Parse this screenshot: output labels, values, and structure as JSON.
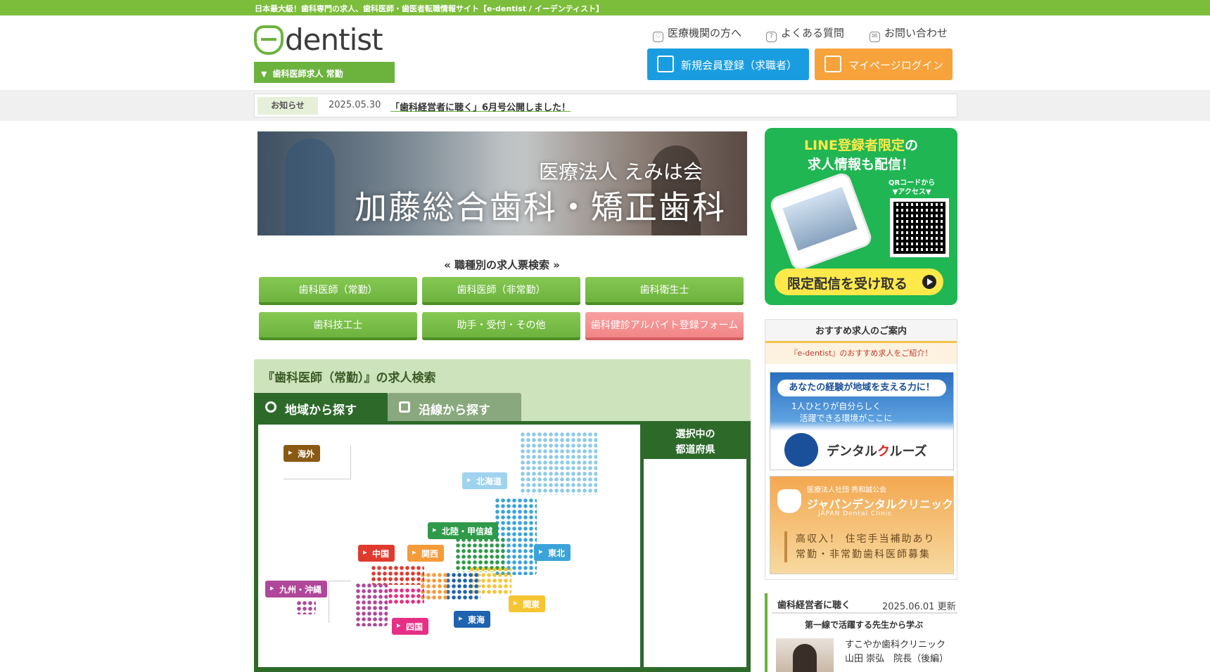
{
  "topbar": {
    "text": "日本最大級！歯科専門の求人、歯科医師・歯医者転職情報サイト【e-dentist / イーデンティスト】"
  },
  "logo": {
    "text": "dentist"
  },
  "job_select": {
    "label": "歯科医師求人 常勤"
  },
  "header_links": [
    {
      "label": "医療機関の方へ",
      "icon": "tooth-icon"
    },
    {
      "label": "よくある質問",
      "icon": "question-icon"
    },
    {
      "label": "お問い合わせ",
      "icon": "mail-icon"
    }
  ],
  "buttons": {
    "register": "新規会員登録（求職者）",
    "login": "マイページログイン"
  },
  "colors": {
    "brand_green": "#6cb33e",
    "register_blue": "#1a9de0",
    "login_orange": "#f7a23b",
    "line_green": "#1fb653"
  },
  "news": {
    "label": "お知らせ",
    "date": "2025.05.30",
    "link": "「歯科経営者に聴く」6月号公開しました！"
  },
  "hero": {
    "sub": "医療法人 えみは会",
    "main": "加藤総合歯科・矯正歯科"
  },
  "job_search": {
    "heading": "« 職種別の求人票検索 »",
    "buttons": [
      {
        "label": "歯科医師（常勤）"
      },
      {
        "label": "歯科医師（非常勤）"
      },
      {
        "label": "歯科衛生士"
      },
      {
        "label": "歯科技工士"
      },
      {
        "label": "助手・受付・その他"
      },
      {
        "label": "歯科健診アルバイト登録フォーム"
      }
    ]
  },
  "search_panel": {
    "title": "『歯科医師（常勤）』の求人検索",
    "tabs": [
      {
        "label": "地域から探す"
      },
      {
        "label": "沿線から探す"
      }
    ],
    "selected_header": "選択中の\n都道府県",
    "regions": {
      "overseas": "海外",
      "hokkaido": "北海道",
      "tohoku": "東北",
      "hokuriku": "北陸・甲信越",
      "kanto": "関東",
      "tokai": "東海",
      "kansai": "関西",
      "chugoku": "中国",
      "shikoku": "四国",
      "kyushu": "九州・沖縄"
    }
  },
  "line_banner": {
    "line1_a": "LINE登録者限定",
    "line1_b": "の",
    "line2": "求人情報も配信！",
    "qr_label": "QRコードから\n▼アクセス▼",
    "cta": "限定配信を受け取る"
  },
  "recommend": {
    "title": "おすすめ求人のご案内",
    "subtitle": "『e-dentist』のおすすめ求人をご紹介！",
    "ad1": {
      "headline": "あなたの経験が地域を支える力に！",
      "sub": "1人ひとりが自分らしく\n   活躍できる環境がここに",
      "name_a": "デンタル",
      "name_b": "ク",
      "name_c": "ルーズ"
    },
    "ad2": {
      "corp": "医療法人社団 秀和誠公会",
      "name": "ジャパンデンタルクリニック",
      "en": "JAPAN Dental Clinic",
      "msg": "高収入！ 住宅手当補助あり\n常勤・非常勤歯科医師募集"
    }
  },
  "management": {
    "title": "歯科経営者に聴く",
    "date": "2025.06.01 更新",
    "subtitle": "第一線で活躍する先生から学ぶ",
    "info": "すこやか歯科クリニック\n山田 崇弘　院長（後編）"
  }
}
